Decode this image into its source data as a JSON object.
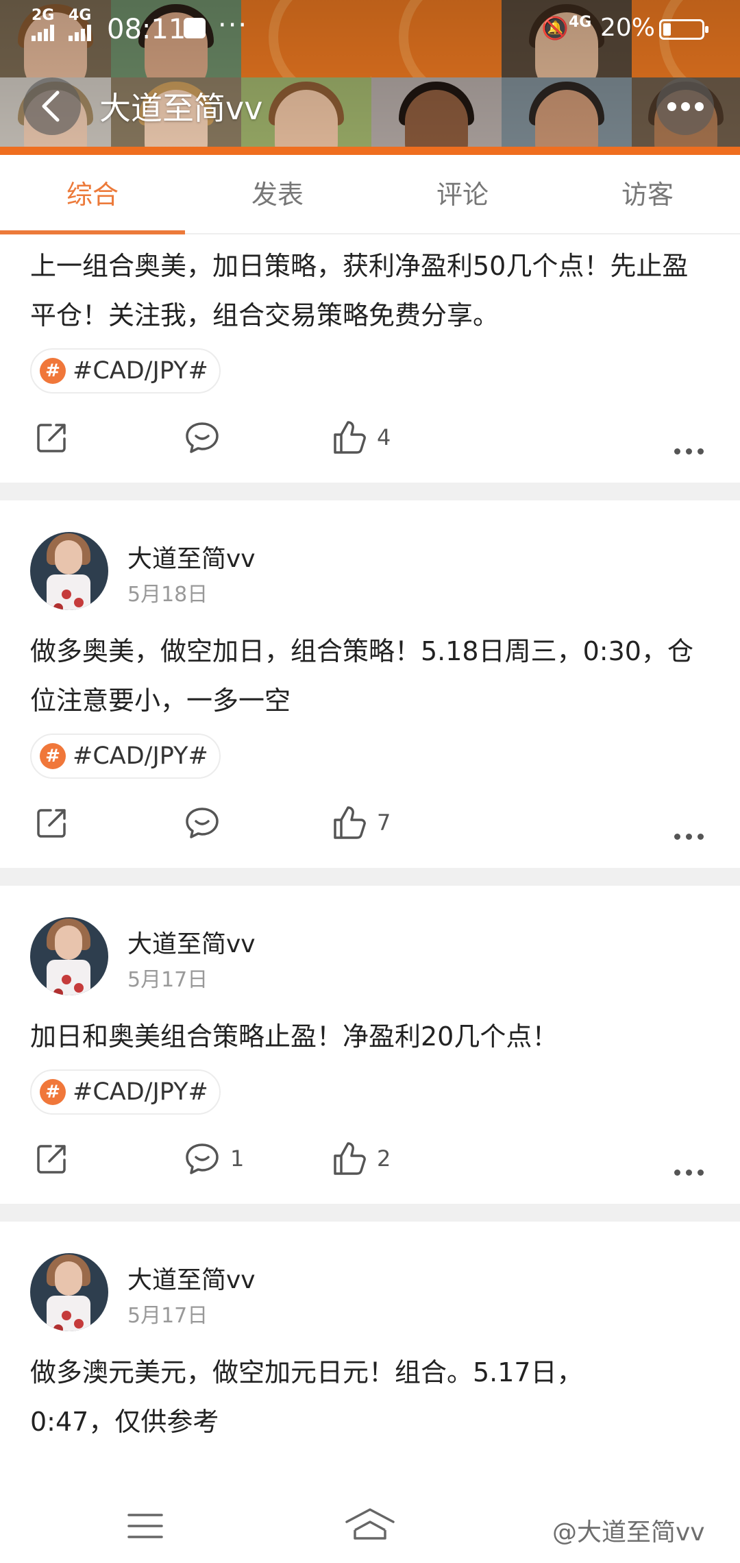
{
  "status_bar": {
    "signal_1": "2G",
    "signal_2": "4G",
    "time": "08:11",
    "extra": "···",
    "network": "4G",
    "battery": "20%",
    "battery_level": 0.2
  },
  "header": {
    "title": "大道至简vv"
  },
  "tabs": [
    {
      "label": "综合",
      "active": true
    },
    {
      "label": "发表",
      "active": false
    },
    {
      "label": "评论",
      "active": false
    },
    {
      "label": "访客",
      "active": false
    }
  ],
  "posts": [
    {
      "text": "上一组合奥美，加日策略，获利净盈利50几个点！先止盈平仓！关注我，组合交易策略免费分享。",
      "topic": "#CAD/JPY#",
      "comments": "",
      "likes": "4"
    },
    {
      "author": "大道至简vv",
      "date": "5月18日",
      "text": "做多奥美，做空加日，组合策略！5.18日周三，0:30，仓位注意要小，一多一空",
      "topic": "#CAD/JPY#",
      "comments": "",
      "likes": "7"
    },
    {
      "author": "大道至简vv",
      "date": "5月17日",
      "text": "加日和奥美组合策略止盈！净盈利20几个点！",
      "topic": "#CAD/JPY#",
      "comments": "1",
      "likes": "2"
    },
    {
      "author": "大道至简vv",
      "date": "5月17日",
      "text": "做多澳元美元，做空加元日元！组合。5.17日，",
      "text_cut": "0:47，仅供参考"
    }
  ],
  "bottom_nav": {
    "watermark": "@大道至简vv"
  },
  "colors": {
    "accent": "#ec7a3a",
    "cover_orange": "#f07a21",
    "separator": "#f0f0f0"
  }
}
